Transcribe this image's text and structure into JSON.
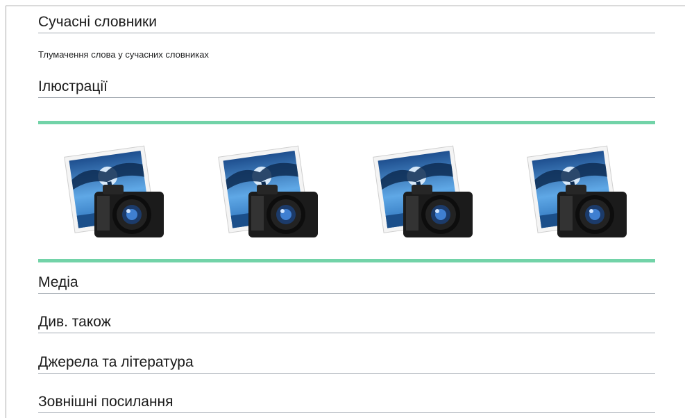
{
  "sections": {
    "modern_dictionaries": "Сучасні словники",
    "modern_dictionaries_desc": "Тлумачення слова у сучасних словниках",
    "illustrations": "Ілюстрації",
    "media": "Медіа",
    "see_also": "Див. також",
    "sources": "Джерела та література",
    "external_links": "Зовнішні посилання"
  },
  "gallery": {
    "items": [
      {
        "icon": "photo-placeholder-icon"
      },
      {
        "icon": "photo-placeholder-icon"
      },
      {
        "icon": "photo-placeholder-icon"
      },
      {
        "icon": "photo-placeholder-icon"
      }
    ],
    "accent_color": "#72d3a8"
  }
}
